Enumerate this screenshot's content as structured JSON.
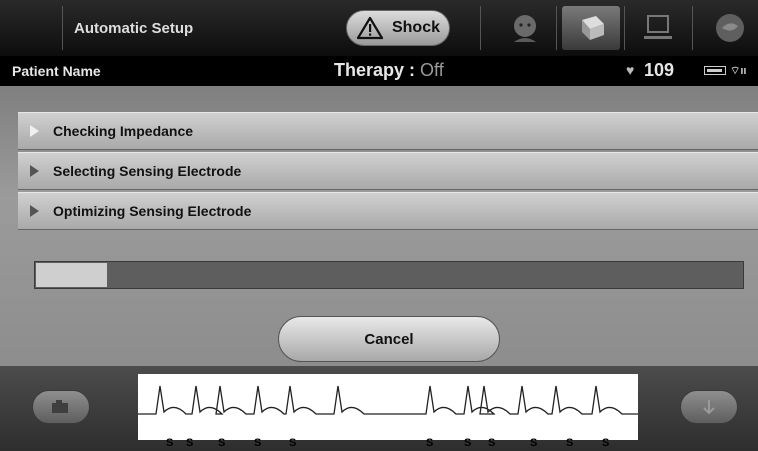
{
  "header": {
    "title": "Automatic Setup",
    "shock_label": "Shock",
    "nav_icons": [
      "patient-icon",
      "programmer-icon",
      "monitor-icon",
      "hand-icon"
    ]
  },
  "status": {
    "patient_name": "Patient Name",
    "therapy_label": "Therapy :",
    "therapy_value": "Off",
    "heart_rate": "109"
  },
  "steps": [
    {
      "label": "Checking Impedance",
      "state": "done"
    },
    {
      "label": "Selecting Sensing Electrode",
      "state": "pending"
    },
    {
      "label": "Optimizing Sensing Electrode",
      "state": "pending"
    }
  ],
  "progress": {
    "fraction": 0.1
  },
  "actions": {
    "cancel_label": "Cancel"
  },
  "ecg": {
    "sense_marker": "S",
    "marker_count": 11
  },
  "colors": {
    "background": "#8a8a8a",
    "header": "#0d0d0d",
    "status_bar": "#000000"
  }
}
